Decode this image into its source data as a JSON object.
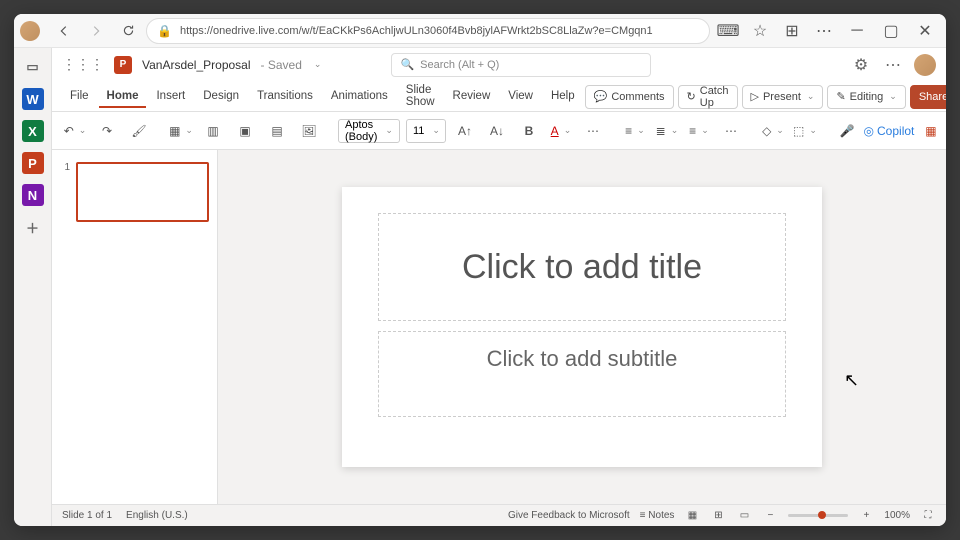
{
  "browser": {
    "url": "https://onedrive.live.com/w/t/EaCKkPs6AchljwULn3060f4Bvb8jylAFWrkt2bSC8LlaZw?e=CMgqn1"
  },
  "dock": {
    "items": [
      {
        "letter": "",
        "bg": "transparent",
        "name": "tab"
      },
      {
        "letter": "W",
        "bg": "#185abd",
        "name": "word"
      },
      {
        "letter": "X",
        "bg": "#107c41",
        "name": "excel"
      },
      {
        "letter": "P",
        "bg": "#c43e1c",
        "name": "powerpoint"
      },
      {
        "letter": "N",
        "bg": "#7719aa",
        "name": "onenote"
      },
      {
        "letter": "+",
        "bg": "transparent",
        "name": "add"
      }
    ]
  },
  "header": {
    "app_initial": "P",
    "doc": "VanArsdel_Proposal",
    "status": "Saved",
    "search_placeholder": "Search (Alt + Q)"
  },
  "tabs": [
    "File",
    "Home",
    "Insert",
    "Design",
    "Transitions",
    "Animations",
    "Slide Show",
    "Review",
    "View",
    "Help"
  ],
  "active_tab": 1,
  "tab_actions": {
    "comments": "Comments",
    "catchup": "Catch Up",
    "present": "Present",
    "editing": "Editing",
    "share": "Share"
  },
  "ribbon": {
    "font": "Aptos (Body)",
    "size": "11",
    "copilot": "Copilot"
  },
  "thumb": {
    "num": "1"
  },
  "slide": {
    "title": "Click to add title",
    "subtitle": "Click to add subtitle"
  },
  "status": {
    "slide": "Slide 1 of 1",
    "lang": "English (U.S.)",
    "feedback": "Give Feedback to Microsoft",
    "notes": "Notes",
    "zoom": "100%"
  }
}
